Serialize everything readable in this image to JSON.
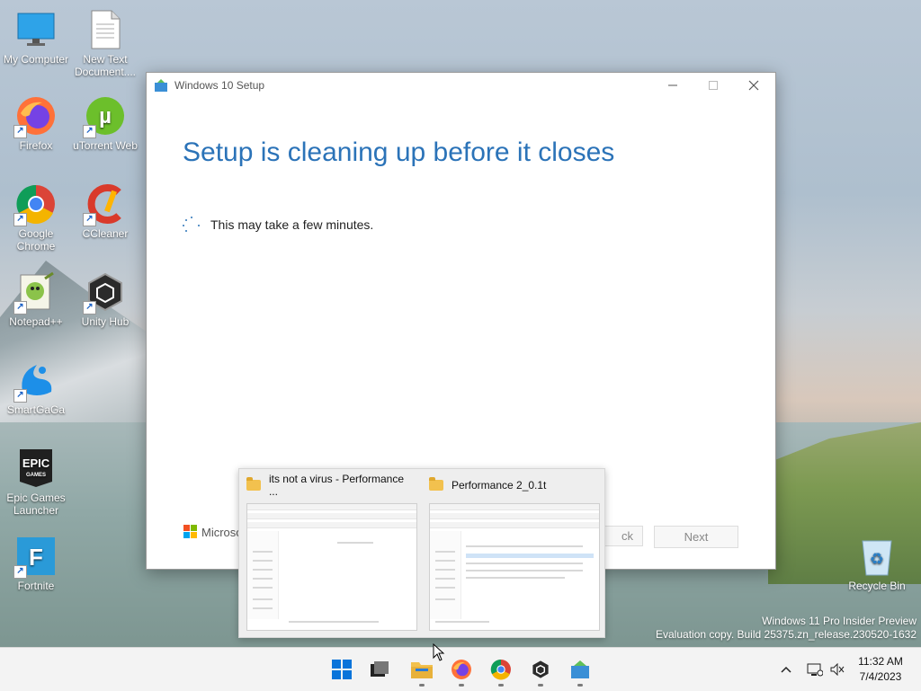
{
  "desktop": {
    "icons": [
      {
        "label": "My Computer",
        "icon": "monitor-icon"
      },
      {
        "label": "New Text Document....",
        "icon": "text-document-icon"
      },
      {
        "label": "Firefox",
        "icon": "firefox-icon"
      },
      {
        "label": "uTorrent Web",
        "icon": "utorrent-icon"
      },
      {
        "label": "Google Chrome",
        "icon": "chrome-icon"
      },
      {
        "label": "CCleaner",
        "icon": "ccleaner-icon"
      },
      {
        "label": "Notepad++",
        "icon": "notepadpp-icon"
      },
      {
        "label": "Unity Hub",
        "icon": "unity-icon"
      },
      {
        "label": "SmartGaGa",
        "icon": "smartgaga-icon"
      },
      {
        "label": "Epic Games Launcher",
        "icon": "epic-games-icon"
      },
      {
        "label": "Fortnite",
        "icon": "fortnite-icon"
      },
      {
        "label": "Recycle Bin",
        "icon": "recycle-bin-icon"
      }
    ]
  },
  "setup_window": {
    "title": "Windows 10 Setup",
    "heading": "Setup is cleaning up before it closes",
    "message": "This may take a few minutes.",
    "brand": "Microso",
    "back_label": "ck",
    "next_label": "Next"
  },
  "previews": [
    {
      "title": "its not a virus - Performance ..."
    },
    {
      "title": "Performance 2_0.1t"
    }
  ],
  "watermark": {
    "line1": "Windows 11 Pro Insider Preview",
    "line2": "Evaluation copy. Build 25375.zn_release.230520-1632"
  },
  "tray": {
    "time": "11:32 AM",
    "date": "7/4/2023"
  },
  "colors": {
    "accent": "#2b73b8"
  }
}
